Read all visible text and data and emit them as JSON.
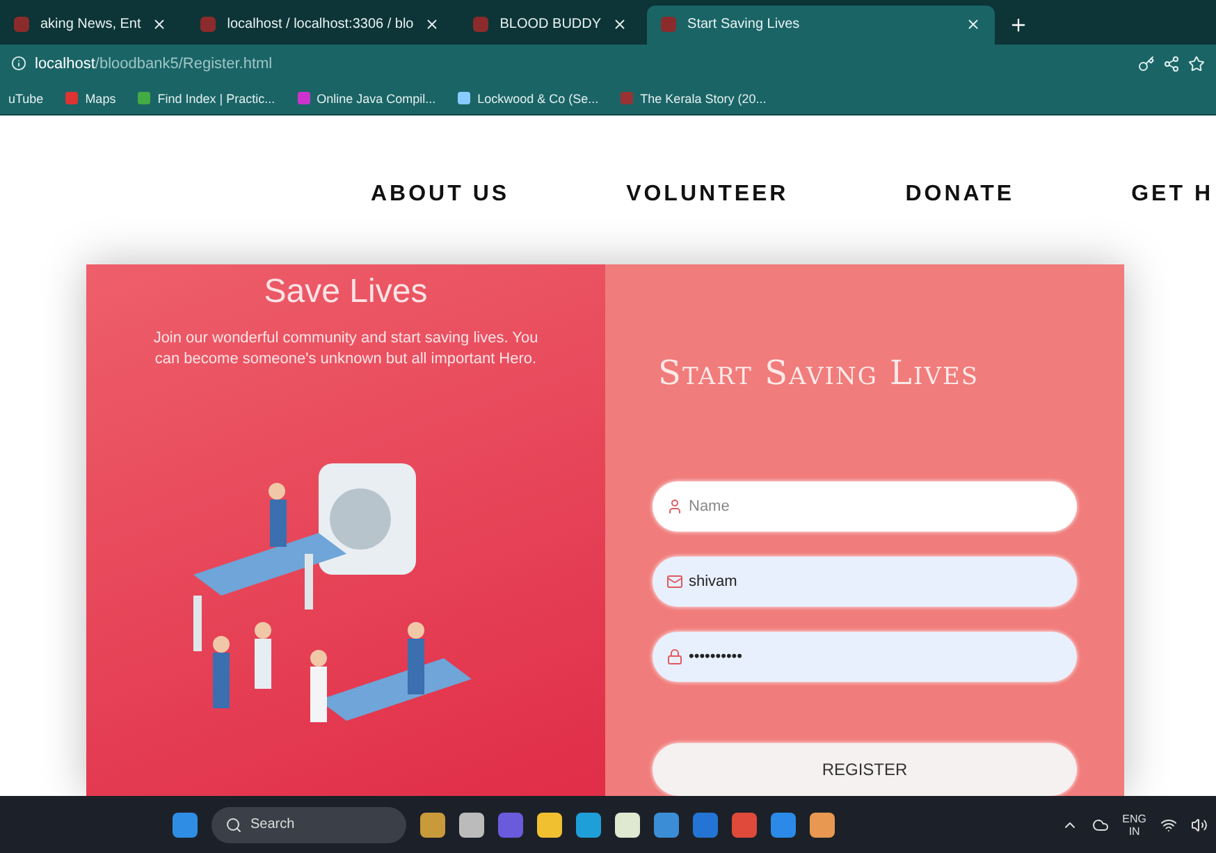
{
  "browser": {
    "tabs": [
      {
        "title": "aking News, Ent",
        "selected": false
      },
      {
        "title": "localhost / localhost:3306 / blo",
        "selected": false
      },
      {
        "title": "BLOOD BUDDY",
        "selected": false
      },
      {
        "title": "Start Saving Lives",
        "selected": true
      }
    ],
    "address": {
      "host": "localhost",
      "path": "/bloodbank5/Register.html"
    },
    "bookmarks": [
      "uTube",
      "Maps",
      "Find Index | Practic...",
      "Online Java Compil...",
      "Lockwood & Co (Se...",
      "The Kerala Story (20..."
    ]
  },
  "nav": [
    "ABOUT US",
    "VOLUNTEER",
    "DONATE",
    "GET H"
  ],
  "hero": {
    "title": "Save Lives",
    "text": "Join our wonderful community and start saving lives. You can become someone's unknown but all important Hero."
  },
  "form": {
    "title": "Start Saving Lives",
    "fields": [
      {
        "kind": "text",
        "placeholder": "Name",
        "autofilled": false
      },
      {
        "kind": "email",
        "value": "shivam",
        "autofilled": true
      },
      {
        "kind": "password",
        "value": "••••••••••",
        "autofilled": true
      }
    ],
    "button": "REGISTER"
  },
  "taskbar": {
    "search": "Search",
    "language": "ENG",
    "region": "IN"
  }
}
